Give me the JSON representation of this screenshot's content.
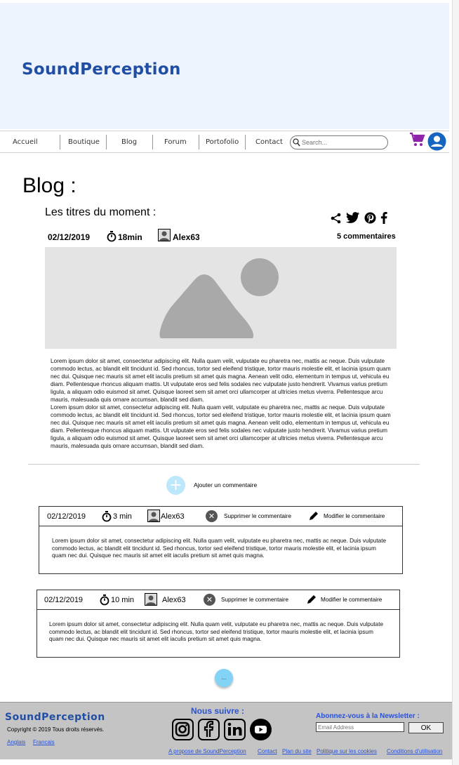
{
  "brand": "SoundPerception",
  "nav": {
    "items": [
      "Accueil",
      "Boutique",
      "Blog",
      "Forum",
      "Portofolio",
      "Contact"
    ],
    "search_placeholder": "Search..."
  },
  "icons": {
    "cart": "shopping-cart-icon",
    "user": "user-account-icon",
    "share": "share-icon",
    "twitter": "twitter-icon",
    "pinterest": "pinterest-icon",
    "facebook": "facebook-icon"
  },
  "colors": {
    "brand": "#1f4ea4",
    "hero_bg": "#eef4fd",
    "cart": "#8e24aa",
    "user": "#1565c0",
    "link": "#2a52d6",
    "add_button": "#bde7fb",
    "more_button": "#82d3f6"
  },
  "blog": {
    "title": "Blog :",
    "section_title": "Les titres du moment :",
    "post": {
      "date": "02/12/2019",
      "duration": "18min",
      "author": "Alex63",
      "comments": "5 commentaires",
      "paragraphs": [
        "Lorem ipsum dolor sit amet, consectetur adipiscing elit. Nulla quam velit, vulputate eu pharetra nec, mattis ac neque. Duis vulputate commodo lectus, ac blandit elit tincidunt id. Sed rhoncus, tortor sed eleifend tristique, tortor mauris molestie elit, et lacinia ipsum quam nec dui. Quisque nec mauris sit amet elit iaculis pretium sit amet quis magna. Aenean velit odio, elementum in tempus ut, vehicula eu diam. Pellentesque rhoncus aliquam mattis. Ut vulputate eros sed felis sodales nec vulputate justo hendrerit. Vivamus varius pretium ligula, a aliquam odio euismod sit amet. Quisque laoreet sem sit amet orci ullamcorper at ultricies metus viverra. Pellentesque arcu mauris, malesuada quis ornare accumsan, blandit sed diam.",
        "Lorem ipsum dolor sit amet, consectetur adipiscing elit. Nulla quam velit, vulputate eu pharetra nec, mattis ac neque. Duis vulputate commodo lectus, ac blandit elit tincidunt id. Sed rhoncus, tortor sed eleifend tristique, tortor mauris molestie elit, et lacinia ipsum quam nec dui. Quisque nec mauris sit amet elit iaculis pretium sit amet quis magna. Aenean velit odio, elementum in tempus ut, vehicula eu diam. Pellentesque rhoncus aliquam mattis. Ut vulputate eros sed felis sodales nec vulputate justo hendrerit. Vivamus varius pretium ligula, a aliquam odio euismod sit amet. Quisque laoreet sem sit amet orci ullamcorper at ultricies metus viverra. Pellentesque arcu mauris, malesuada quis ornare accumsan, blandit sed diam."
      ]
    },
    "add_comment_label": "Ajouter un commentaire",
    "more_label": "...",
    "comments": [
      {
        "date": "02/12/2019",
        "duration": "3 min",
        "author": "Alex63",
        "delete_label": "Supprimer le commentaire",
        "edit_label": "Modifier le commentaire",
        "text": "Lorem ipsum dolor sit amet, consectetur adipiscing elit. Nulla quam velit, vulputate eu pharetra nec, mattis ac neque. Duis vulputate commodo lectus, ac blandit elit tincidunt id. Sed rhoncus, tortor sed eleifend tristique, tortor mauris molestie elit, et lacinia ipsum quam nec dui. Quisque nec mauris sit amet elit iaculis pretium sit amet quis magna."
      },
      {
        "date": "02/12/2019",
        "duration": "10 min",
        "author": "Alex63",
        "delete_label": "Supprimer le commentaire",
        "edit_label": "Modifier le commentaire",
        "text": "Lorem ipsum dolor sit amet, consectetur adipiscing elit. Nulla quam velit, vulputate eu pharetra nec, mattis ac neque. Duis vulputate commodo lectus, ac blandit elit tincidunt id. Sed rhoncus, tortor sed eleifend tristique, tortor mauris molestie elit, et lacinia ipsum quam nec dui. Quisque nec mauris sit amet elit iaculis pretium sit amet quis magna."
      }
    ]
  },
  "footer": {
    "brand": "SoundPerception",
    "copyright": "Copyright © 2019 Tous droits réservés.",
    "languages": [
      "Anglais",
      "Francais"
    ],
    "follow_title": "Nous suivre :",
    "social_icons": [
      "instagram-icon",
      "facebook-icon",
      "linkedin-icon",
      "youtube-icon"
    ],
    "newsletter_title": "Abonnez-vous à la Newsletter :",
    "email_placeholder": "Email Address",
    "ok_label": "OK",
    "links": [
      "A propose de SoundPerception",
      "Contact",
      "Plan du site",
      "Politique sur les cookies",
      "Conditions d'utilisation"
    ]
  }
}
